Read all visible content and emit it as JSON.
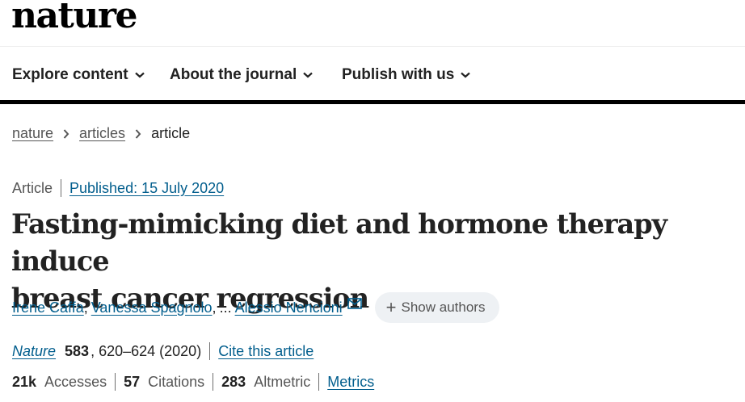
{
  "header": {
    "logo": "nature"
  },
  "nav": {
    "items": [
      {
        "label": "Explore content"
      },
      {
        "label": "About the journal"
      },
      {
        "label": "Publish with us"
      }
    ]
  },
  "breadcrumb": {
    "items": [
      {
        "label": "nature"
      },
      {
        "label": "articles"
      },
      {
        "label": "article"
      }
    ]
  },
  "article": {
    "type": "Article",
    "published": "Published: 15 July 2020",
    "title_line1": "Fasting-mimicking diet and hormone therapy induce",
    "title_line2": "breast cancer regression",
    "authors": [
      "Irene Caffa",
      "Vanessa Spagnolo",
      "Alessio Nencioni"
    ],
    "author_separator": ",",
    "ellipsis": "...",
    "show_authors_label": "Show authors",
    "journal": "Nature",
    "volume": "583",
    "pages_year": ", 620–624 (2020)",
    "cite_label": "Cite this article"
  },
  "metrics": {
    "accesses_value": "21k",
    "accesses_label": "Accesses",
    "citations_value": "57",
    "citations_label": "Citations",
    "altmetric_value": "283",
    "altmetric_label": "Altmetric",
    "metrics_link": "Metrics"
  },
  "colors": {
    "link": "#025e8d",
    "text": "#222222",
    "muted": "#555555",
    "pill_bg": "#eef1f4"
  },
  "icons": [
    "chevron-down-icon",
    "chevron-right-icon",
    "mail-icon",
    "plus-icon"
  ]
}
